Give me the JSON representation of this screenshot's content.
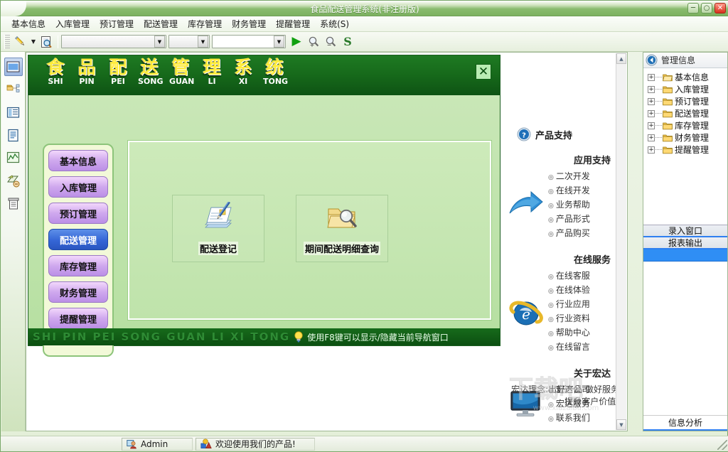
{
  "window": {
    "title": "食品配送管理系统(非注册版)",
    "minimize_label": "─",
    "maximize_label": "○",
    "close_label": "✕"
  },
  "menubar": {
    "items": [
      {
        "label": "基本信息"
      },
      {
        "label": "入库管理"
      },
      {
        "label": "预订管理"
      },
      {
        "label": "配送管理"
      },
      {
        "label": "库存管理"
      },
      {
        "label": "财务管理"
      },
      {
        "label": "提醒管理"
      },
      {
        "label": "系统(S)"
      }
    ]
  },
  "toolbar": {
    "edit_icon": "pencil-icon",
    "dropdown_caret": "▼",
    "find_icon": "search-document-icon",
    "combo1_value": "",
    "combo2_value": "",
    "combo3_value": "",
    "run_icon": "▶",
    "zoom_in_icon": "zoom-in-icon",
    "zoom_out_icon": "zoom-out-icon",
    "refresh_icon": "S"
  },
  "left_strip": {
    "items": [
      {
        "name": "window-view-icon",
        "selected": true
      },
      {
        "name": "folder-tree-icon",
        "selected": false
      },
      {
        "name": "list-view-icon",
        "selected": false
      },
      {
        "name": "document-icon",
        "selected": false
      },
      {
        "name": "chart-icon",
        "selected": false
      },
      {
        "name": "print-preview-icon",
        "selected": false
      },
      {
        "name": "report-print-icon",
        "selected": false
      }
    ]
  },
  "mdi": {
    "close_label": "✕",
    "title_chars": [
      {
        "cn": "食",
        "py": "SHI"
      },
      {
        "cn": "品",
        "py": "PIN"
      },
      {
        "cn": "配",
        "py": "PEI"
      },
      {
        "cn": "送",
        "py": "SONG"
      },
      {
        "cn": "管",
        "py": "GUAN"
      },
      {
        "cn": "理",
        "py": "LI"
      },
      {
        "cn": "系",
        "py": "XI"
      },
      {
        "cn": "统",
        "py": "TONG"
      }
    ],
    "nav_buttons": [
      {
        "label": "基本信息",
        "active": false
      },
      {
        "label": "入库管理",
        "active": false
      },
      {
        "label": "预订管理",
        "active": false
      },
      {
        "label": "配送管理",
        "active": true
      },
      {
        "label": "库存管理",
        "active": false
      },
      {
        "label": "财务管理",
        "active": false
      },
      {
        "label": "提醒管理",
        "active": false
      }
    ],
    "content_icons": [
      {
        "label": "配送登记",
        "icon": "document-pen-icon"
      },
      {
        "label": "期间配送明细查询",
        "icon": "folder-search-icon"
      }
    ],
    "footer_pinyin": "SHI PIN PEI SONG GUAN LI XI TONG",
    "footer_tip": "使用F8键可以显示/隐藏当前导航窗口",
    "footer_tip_icon": "lightbulb-icon"
  },
  "support": {
    "header_icon": "help-question-icon",
    "header_title": "产品支持",
    "sections": [
      {
        "title": "应用支持",
        "icon": "blue-arrow-icon",
        "links": [
          "二次开发",
          "在线开发",
          "业务帮助",
          "产品形式",
          "产品购买"
        ]
      },
      {
        "title": "在线服务",
        "icon": "internet-explorer-icon",
        "links": [
          "在线客服",
          "在线体验",
          "行业应用",
          "行业资料",
          "帮助中心",
          "在线留言"
        ]
      },
      {
        "title": "关于宏达",
        "icon": "monitor-icon",
        "links": [
          "宏达公司",
          "宏达服务",
          "联系我们"
        ]
      }
    ],
    "slogan": "宏达理念:出好产品 做好服务 提升客户价值!"
  },
  "right_dock": {
    "header_icon": "collapse-left-icon",
    "header_title": "管理信息",
    "tree_items": [
      {
        "label": "基本信息",
        "expander": "+",
        "folder": "folder-open-icon"
      },
      {
        "label": "入库管理",
        "expander": "+",
        "folder": "folder-icon"
      },
      {
        "label": "预订管理",
        "expander": "+",
        "folder": "folder-icon"
      },
      {
        "label": "配送管理",
        "expander": "+",
        "folder": "folder-icon"
      },
      {
        "label": "库存管理",
        "expander": "+",
        "folder": "folder-icon"
      },
      {
        "label": "财务管理",
        "expander": "+",
        "folder": "folder-icon"
      },
      {
        "label": "提醒管理",
        "expander": "+",
        "folder": "folder-icon"
      }
    ],
    "panels": [
      {
        "label": "录入窗口",
        "selected": false
      },
      {
        "label": "报表输出",
        "selected": false
      },
      {
        "label": "",
        "selected": true
      }
    ],
    "bottom_panel": "信息分析"
  },
  "statusbar": {
    "user_icon": "user-icon",
    "user": "Admin",
    "message_icon": "info-shapes-icon",
    "message": "欢迎使用我们的产品!"
  },
  "watermark": {
    "big": "下载吧",
    "small": "www.xiazaiba.com"
  },
  "colors": {
    "title_green": "#7cb160",
    "banner_green": "#176b1b",
    "accent_yellow": "#ffeb3b",
    "selected_blue": "#3566d6",
    "nav_purple": "#cfa8ee"
  }
}
